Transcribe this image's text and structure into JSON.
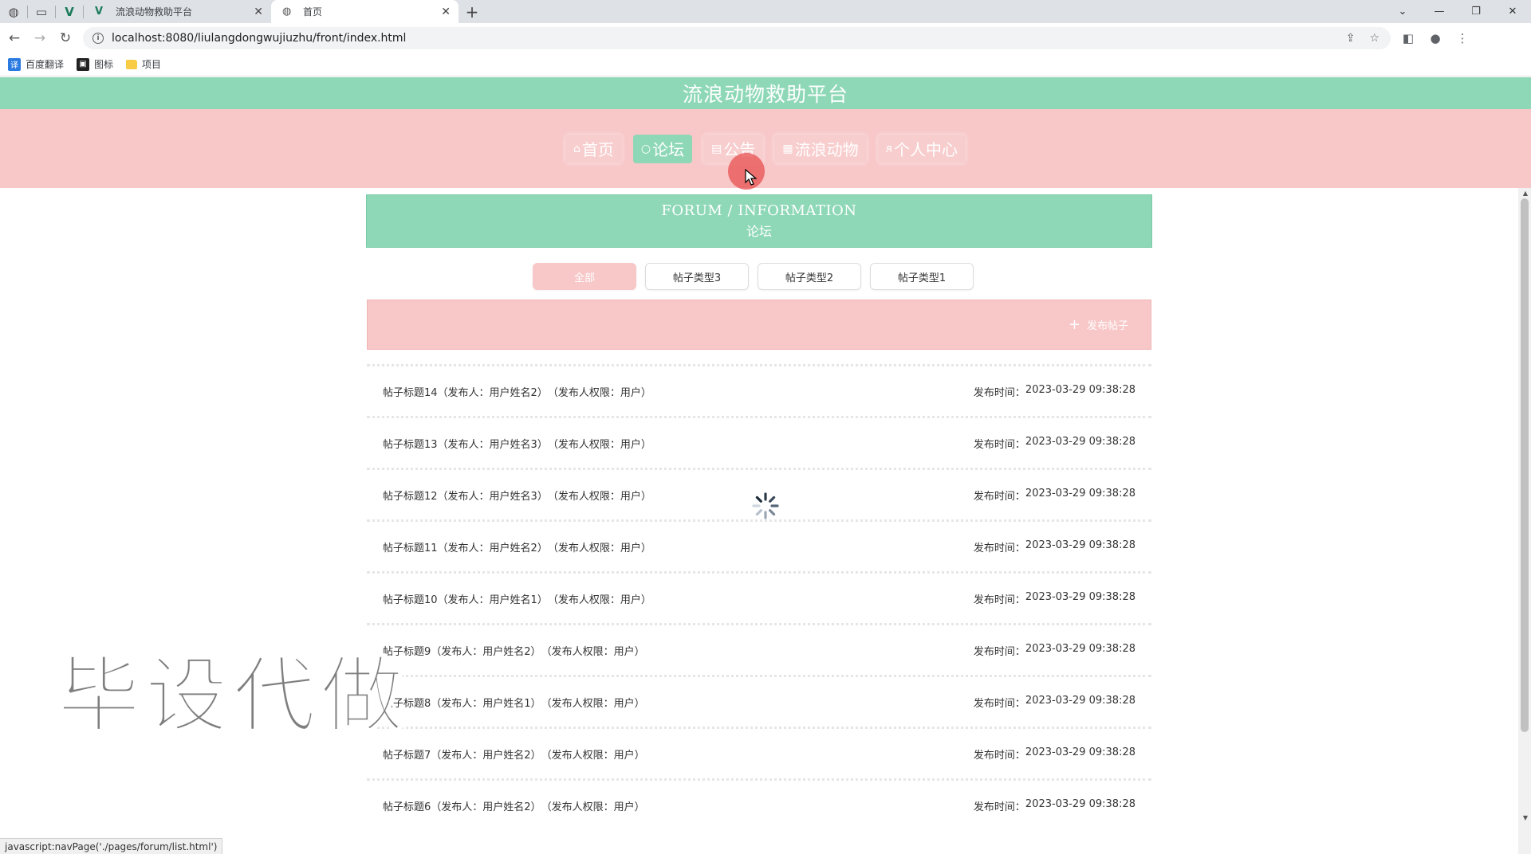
{
  "browser": {
    "tabs": [
      {
        "title": "流浪动物救助平台",
        "icon": "vue-logo-icon",
        "active": false
      },
      {
        "title": "首页",
        "icon": "globe-icon",
        "active": true
      }
    ],
    "url": "localhost:8080/liulangdongwujiuzhu/front/index.html",
    "bookmarks": [
      {
        "label": "百度翻译",
        "icon": "translate-icon"
      },
      {
        "label": "图标",
        "icon": "image-icon"
      },
      {
        "label": "项目",
        "icon": "folder-icon"
      }
    ],
    "status_text": "javascript:navPage('./pages/forum/list.html')"
  },
  "site": {
    "title": "流浪动物救助平台",
    "nav": [
      {
        "label": "首页",
        "icon": "home-icon",
        "glyph": "⌂",
        "active": false
      },
      {
        "label": "论坛",
        "icon": "forum-icon",
        "glyph": "○",
        "active": true
      },
      {
        "label": "公告",
        "icon": "notice-icon",
        "glyph": "▤",
        "active": false
      },
      {
        "label": "流浪动物",
        "icon": "animal-icon",
        "glyph": "▦",
        "active": false
      },
      {
        "label": "个人中心",
        "icon": "user-icon",
        "glyph": "ᴙ",
        "active": false
      }
    ]
  },
  "banner": {
    "en": "FORUM / INFORMATION",
    "cn": "论坛"
  },
  "filters": [
    {
      "label": "全部",
      "active": true
    },
    {
      "label": "帖子类型3",
      "active": false
    },
    {
      "label": "帖子类型2",
      "active": false
    },
    {
      "label": "帖子类型1",
      "active": false
    }
  ],
  "actions": {
    "post_label": "发布帖子"
  },
  "posts": [
    {
      "title": "帖子标题14",
      "author": "（发布人：用户姓名2）",
      "role": "（发布人权限：用户）",
      "time_label": "发布时间：",
      "time": "2023-03-29 09:38:28"
    },
    {
      "title": "帖子标题13",
      "author": "（发布人：用户姓名3）",
      "role": "（发布人权限：用户）",
      "time_label": "发布时间：",
      "time": "2023-03-29 09:38:28"
    },
    {
      "title": "帖子标题12",
      "author": "（发布人：用户姓名3）",
      "role": "（发布人权限：用户）",
      "time_label": "发布时间：",
      "time": "2023-03-29 09:38:28"
    },
    {
      "title": "帖子标题11",
      "author": "（发布人：用户姓名2）",
      "role": "（发布人权限：用户）",
      "time_label": "发布时间：",
      "time": "2023-03-29 09:38:28"
    },
    {
      "title": "帖子标题10",
      "author": "（发布人：用户姓名1）",
      "role": "（发布人权限：用户）",
      "time_label": "发布时间：",
      "time": "2023-03-29 09:38:28"
    },
    {
      "title": "帖子标题9",
      "author": "（发布人：用户姓名2）",
      "role": "（发布人权限：用户）",
      "time_label": "发布时间：",
      "time": "2023-03-29 09:38:28"
    },
    {
      "title": "帖子标题8",
      "author": "（发布人：用户姓名1）",
      "role": "（发布人权限：用户）",
      "time_label": "发布时间：",
      "time": "2023-03-29 09:38:28"
    },
    {
      "title": "帖子标题7",
      "author": "（发布人：用户姓名2）",
      "role": "（发布人权限：用户）",
      "time_label": "发布时间：",
      "time": "2023-03-29 09:38:28"
    },
    {
      "title": "帖子标题6",
      "author": "（发布人：用户姓名2）",
      "role": "（发布人权限：用户）",
      "time_label": "发布时间：",
      "time": "2023-03-29 09:38:28"
    }
  ],
  "watermark": "毕设代做",
  "colors": {
    "mint": "#8ed8b7",
    "pink": "#f8c7c8"
  }
}
